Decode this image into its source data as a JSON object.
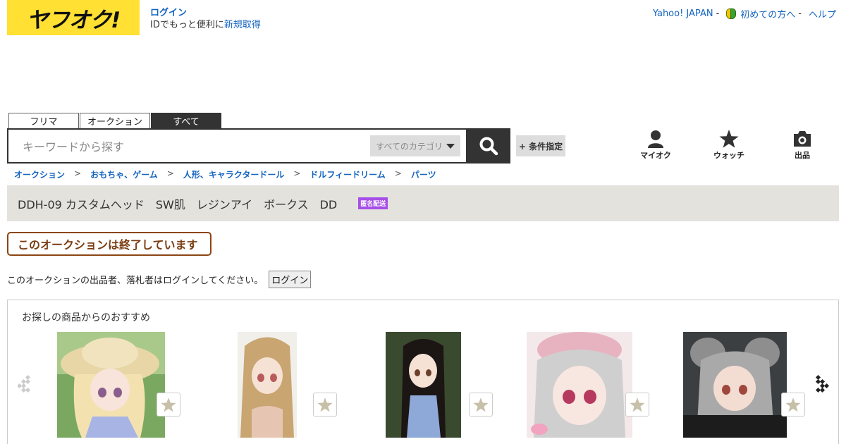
{
  "header": {
    "logo_text": "ヤフオク!",
    "login_label": "ログイン",
    "promo_text": "IDでもっと便利に",
    "signup_label": "新規取得",
    "links": [
      {
        "label": "Yahoo! JAPAN"
      },
      {
        "label": "初めての方へ"
      },
      {
        "label": "ヘルプ"
      }
    ],
    "separator": "-"
  },
  "tabs": [
    {
      "label": "フリマ",
      "active": false
    },
    {
      "label": "オークション",
      "active": false
    },
    {
      "label": "すべて",
      "active": true
    }
  ],
  "search": {
    "placeholder": "キーワードから探す",
    "category_label": "すべてのカテゴリ",
    "conditions_label": "+ 条件指定"
  },
  "top_nav": {
    "myauc": "マイオク",
    "watch": "ウォッチ",
    "sell": "出品"
  },
  "breadcrumb": [
    "オークション",
    "おもちゃ、ゲーム",
    "人形、キャラクタードール",
    "ドルフィードリーム",
    "パーツ"
  ],
  "breadcrumb_separator": ">",
  "item": {
    "title": "DDH-09 カスタムヘッド　SW肌　レジンアイ　ボークス　DD",
    "badge": "匿名配送"
  },
  "ended_notice": "このオークションは終了しています",
  "login_note": "このオークションの出品者、落札者はログインしてください。",
  "login_button": "ログイン",
  "recommend": {
    "title": "お探しの商品からのおすすめ"
  },
  "colors": {
    "logo_bg": "#ffe033",
    "link": "#1565c0",
    "badge": "#a64fe8",
    "ended": "#7a3d12"
  }
}
